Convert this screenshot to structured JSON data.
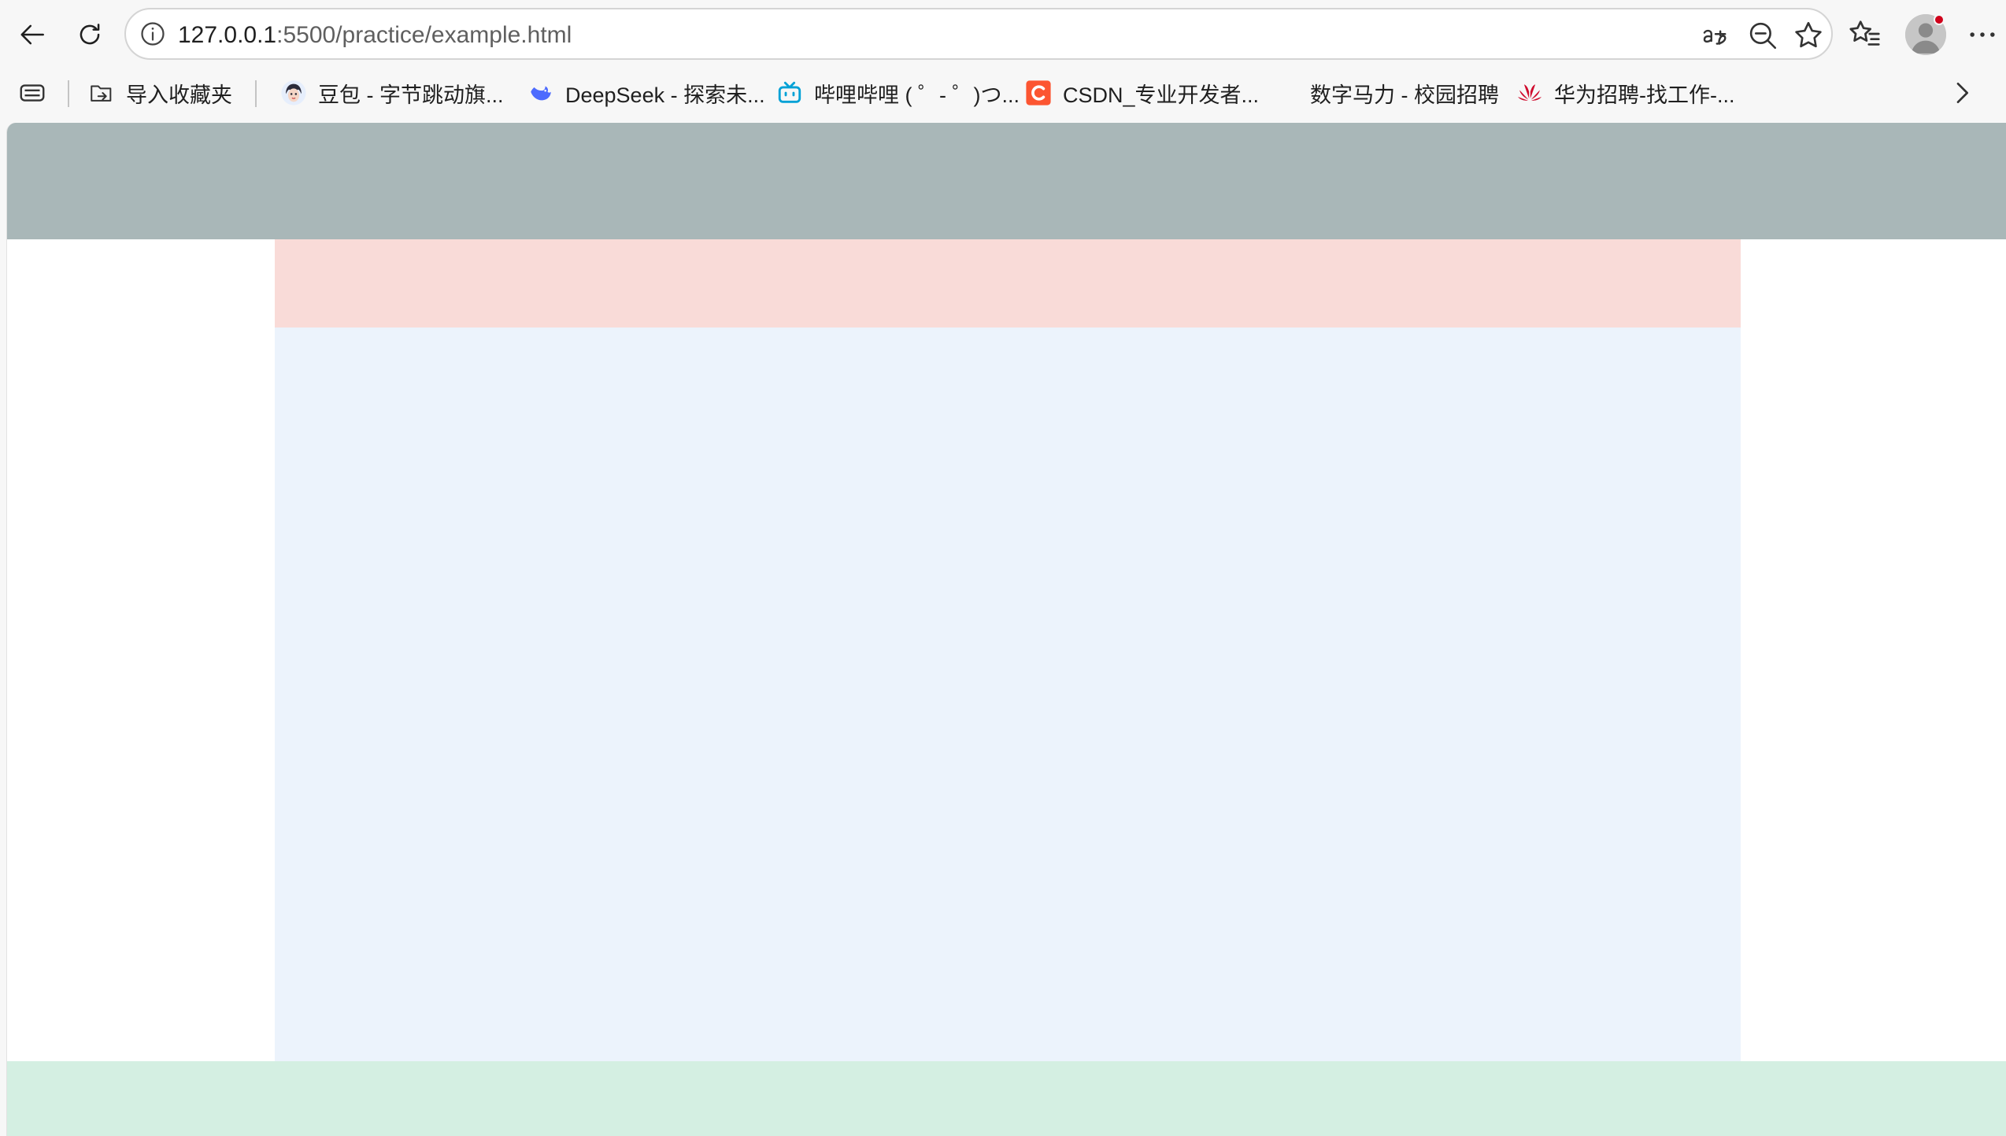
{
  "browser": {
    "url_host": "127.0.0.1",
    "url_path": ":5500/practice/example.html",
    "icons": {
      "back": "back-arrow-icon",
      "reload": "reload-icon",
      "info": "info-icon",
      "read_aloud": "read-aloud-icon",
      "zoom": "zoom-out-icon",
      "favorite": "star-icon",
      "favorites_list": "favorites-list-icon",
      "profile": "profile-avatar-icon",
      "more": "more-icon"
    }
  },
  "bookmarks": {
    "items": [
      {
        "label": "导入收藏夹",
        "icon": "import-folder-icon"
      },
      {
        "label": "豆包 - 字节跳动旗...",
        "icon": "doubao-icon"
      },
      {
        "label": "DeepSeek - 探索未...",
        "icon": "deepseek-whale-icon"
      },
      {
        "label": "哔哩哔哩 ( ゜- ゜)つ...",
        "icon": "bilibili-tv-icon"
      },
      {
        "label": "CSDN_专业开发者...",
        "icon": "csdn-icon"
      },
      {
        "label": "数字马力 - 校园招聘",
        "icon": ""
      },
      {
        "label": "华为招聘-找工作-...",
        "icon": "huawei-icon"
      }
    ],
    "overflow_icon": "chevron-right-icon"
  },
  "colors": {
    "header": "#a9b7b8",
    "nav": "#f9dbd8",
    "main": "#ecf3fc",
    "footer": "#d4efe2",
    "csdn": "#fc5531",
    "bilibili": "#00a1d6",
    "deepseek": "#4d6bfe",
    "huawei": "#cf0a2c"
  }
}
